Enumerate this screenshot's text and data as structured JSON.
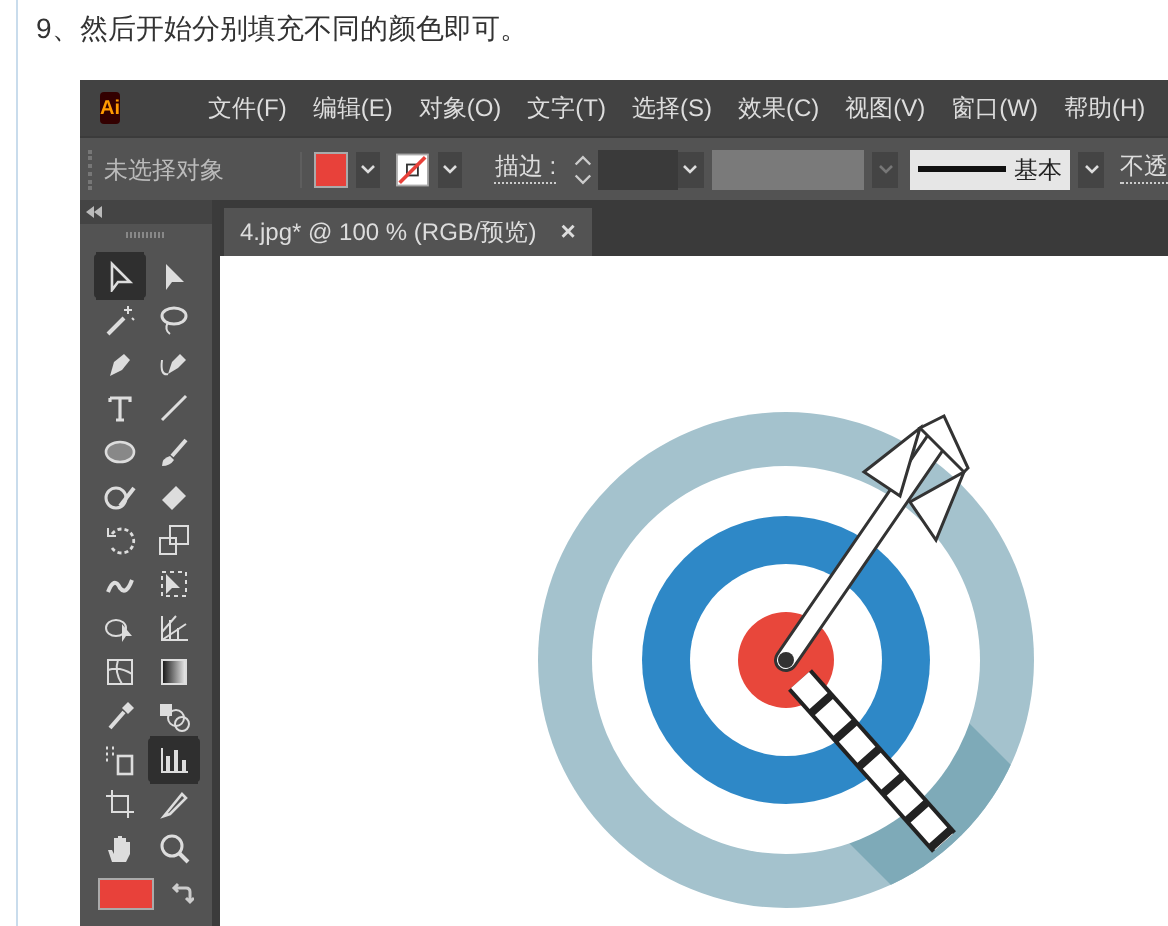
{
  "article": {
    "step_text": "9、然后开始分别填充不同的颜色即可。"
  },
  "app": {
    "logo": "Ai",
    "menus": [
      "文件(F)",
      "编辑(E)",
      "对象(O)",
      "文字(T)",
      "选择(S)",
      "效果(C)",
      "视图(V)",
      "窗口(W)",
      "帮助(H)"
    ],
    "control_bar": {
      "selection_label": "未选择对象",
      "stroke_label": "描边 :",
      "style_label": "基本",
      "opacity_label": "不透"
    },
    "document_tab": {
      "title": "4.jpg* @ 100 % (RGB/预览)",
      "close": "×"
    },
    "tools": [
      {
        "kind": "selection",
        "selected": true
      },
      {
        "kind": "direct-selection",
        "selected": false
      },
      {
        "kind": "magic-wand",
        "selected": false
      },
      {
        "kind": "lasso",
        "selected": false
      },
      {
        "kind": "pen",
        "selected": false
      },
      {
        "kind": "curvature",
        "selected": false
      },
      {
        "kind": "type",
        "selected": false
      },
      {
        "kind": "line",
        "selected": false
      },
      {
        "kind": "ellipse",
        "selected": false
      },
      {
        "kind": "brush",
        "selected": false
      },
      {
        "kind": "shaper",
        "selected": false
      },
      {
        "kind": "eraser",
        "selected": false
      },
      {
        "kind": "rotate",
        "selected": false
      },
      {
        "kind": "scale",
        "selected": false
      },
      {
        "kind": "warp",
        "selected": false
      },
      {
        "kind": "free-transform",
        "selected": false
      },
      {
        "kind": "shape-builder",
        "selected": false
      },
      {
        "kind": "perspective",
        "selected": false
      },
      {
        "kind": "mesh",
        "selected": false
      },
      {
        "kind": "gradient",
        "selected": false
      },
      {
        "kind": "eyedropper",
        "selected": false
      },
      {
        "kind": "blend",
        "selected": false
      },
      {
        "kind": "sprayer",
        "selected": false
      },
      {
        "kind": "graph",
        "selected": true
      },
      {
        "kind": "artboard",
        "selected": false
      },
      {
        "kind": "slice",
        "selected": false
      },
      {
        "kind": "hand",
        "selected": false
      },
      {
        "kind": "zoom",
        "selected": false
      }
    ]
  }
}
